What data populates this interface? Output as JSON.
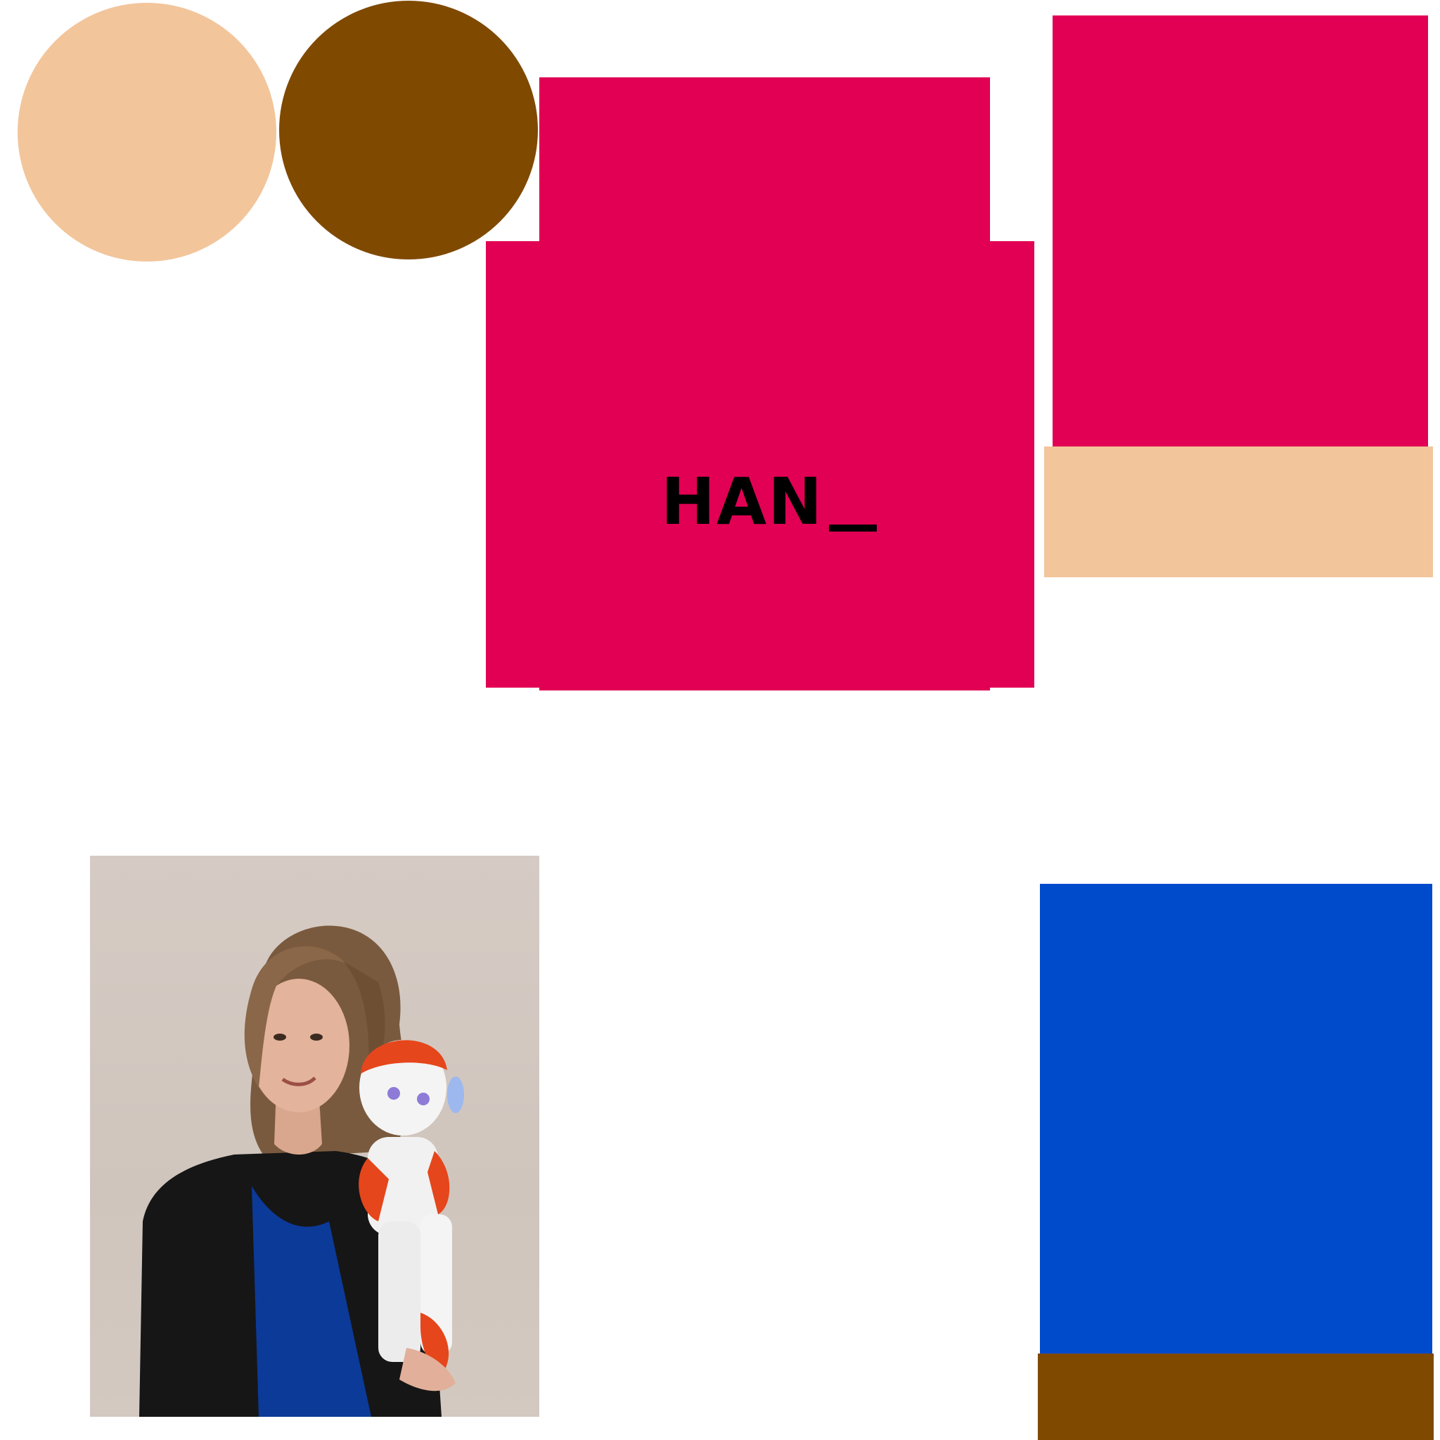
{
  "logo": {
    "text": "HAN",
    "suffix": "_"
  },
  "colors": {
    "background": "#ffffff",
    "peach": "#f2c59b",
    "brown": "#7f4900",
    "magenta": "#e20054",
    "blue": "#004acc"
  },
  "photo": {
    "subject": "person-holding-robot-photo"
  }
}
